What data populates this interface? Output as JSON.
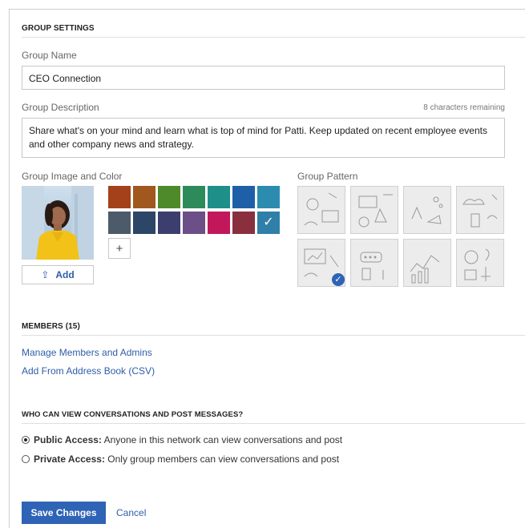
{
  "group_settings": {
    "title": "GROUP SETTINGS",
    "name_label": "Group Name",
    "name_value": "CEO Connection",
    "description_label": "Group Description",
    "chars_remaining": "8 characters remaining",
    "description_value": "Share what's on your mind and learn what is top of mind for Patti. Keep updated on recent employee events and other company news and strategy.",
    "image_color_label": "Group Image and Color",
    "add_label": "Add",
    "plus_label": "+",
    "pattern_label": "Group Pattern",
    "colors": [
      "#a3421a",
      "#a0581e",
      "#4e8a2a",
      "#2d8a5a",
      "#1f8f8a",
      "#1f5fa8",
      "#2c8cb0",
      "#4d5a6a",
      "#2d4566",
      "#3c3f6e",
      "#6b4f86",
      "#c2185b",
      "#8a2f3e",
      "#2f7fa8"
    ],
    "selected_color_index": 13,
    "selected_pattern_index": 4
  },
  "members": {
    "title": "MEMBERS (15)",
    "manage_link": "Manage Members and Admins",
    "add_link": "Add From Address Book (CSV)"
  },
  "access": {
    "title": "WHO CAN VIEW CONVERSATIONS AND POST MESSAGES?",
    "public_bold": "Public Access:",
    "public_text": " Anyone in this network can view conversations and post",
    "private_bold": "Private Access:",
    "private_text": " Only group members can view conversations and post",
    "selected": "public"
  },
  "actions": {
    "save_label": "Save Changes",
    "cancel_label": "Cancel"
  }
}
